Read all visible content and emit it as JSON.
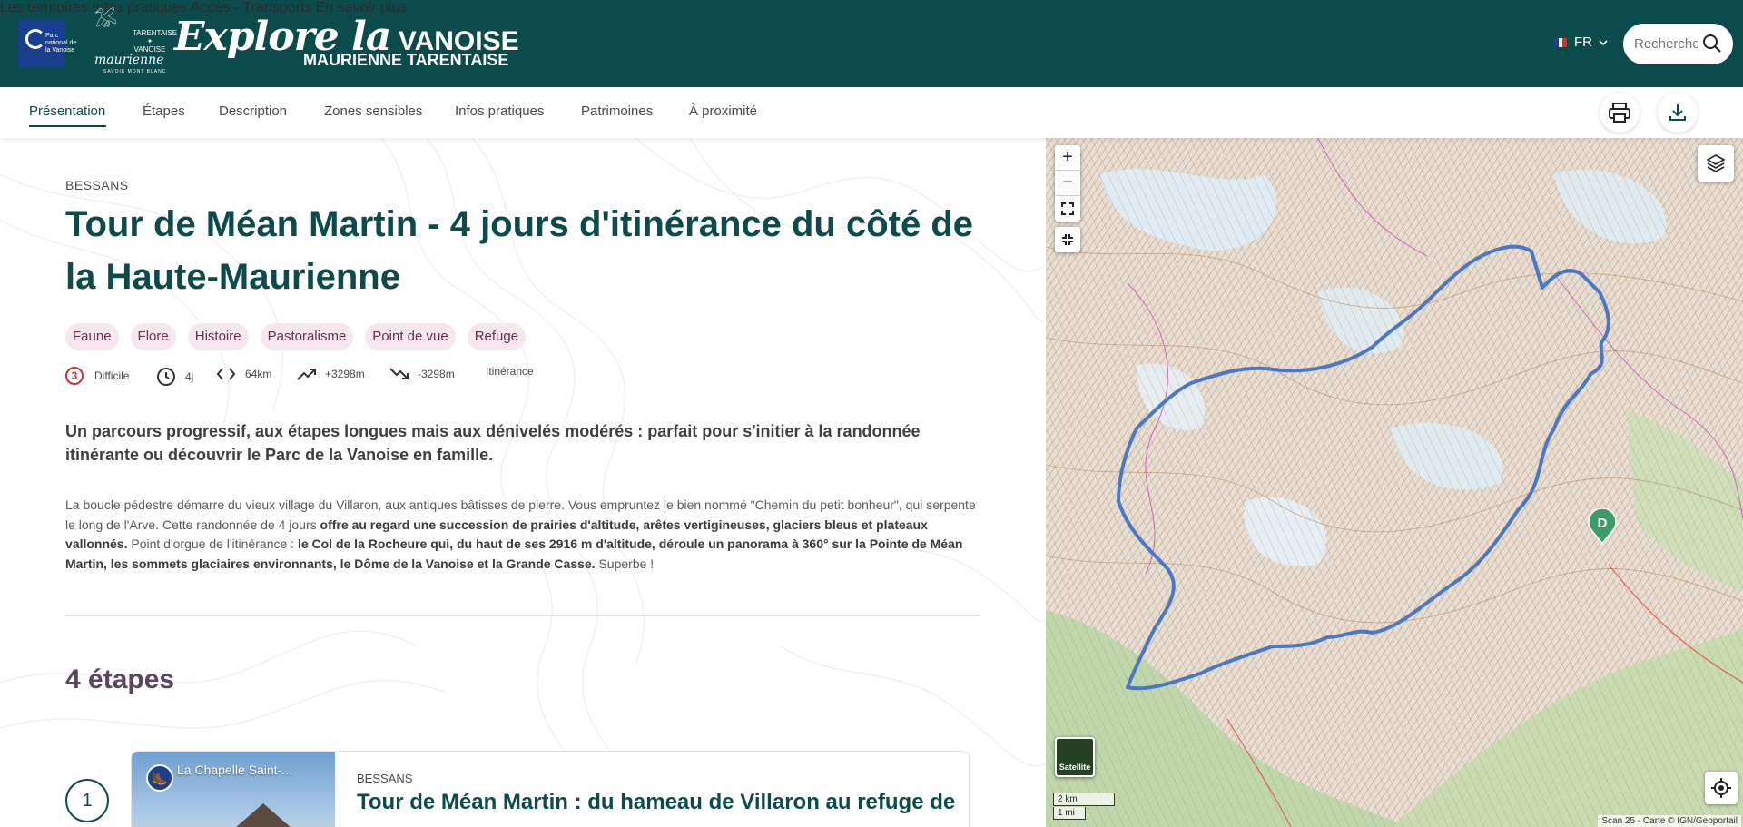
{
  "header": {
    "park_logo_text": "Parc national de la Vanoise",
    "tarentaise_text": "TARENTAISE ✦ VANOISE",
    "maurienne_text": "maurienne",
    "maurienne_sub": "SAVOIE MONT BLANC",
    "brand_script": "Explore la",
    "brand_caps": "VANOISE",
    "brand_sub": "MAURIENNE TARENTAISE",
    "nav": [
      {
        "label": "Les territoires"
      },
      {
        "label": "Infos pratiques"
      },
      {
        "label": "Accès - Transports"
      },
      {
        "label": "En savoir plus"
      }
    ],
    "language": "FR",
    "search_placeholder": "Recherche"
  },
  "subnav": {
    "tabs": [
      {
        "label": "Présentation",
        "active": true
      },
      {
        "label": "Étapes"
      },
      {
        "label": "Description"
      },
      {
        "label": "Zones sensibles"
      },
      {
        "label": "Infos pratiques"
      },
      {
        "label": "Patrimoines"
      },
      {
        "label": "À proximité"
      }
    ]
  },
  "trek": {
    "place": "BESSANS",
    "title": "Tour de Méan Martin - 4 jours d'itinérance du côté de la Haute-Maurienne",
    "tags": [
      "Faune",
      "Flore",
      "Histoire",
      "Pastoralisme",
      "Point de vue",
      "Refuge"
    ],
    "stats": {
      "difficulty_level": "3",
      "difficulty": "Difficile",
      "duration": "4j",
      "distance": "64km",
      "ascent": "+3298m",
      "descent": "-3298m",
      "practice": "Itinérance"
    },
    "lead": "Un parcours progressif, aux étapes longues mais aux dénivelés modérés : parfait pour s'initier à la randonnée itinérante ou découvrir le Parc de la Vanoise en famille.",
    "desc": {
      "p1": "La boucle pédestre démarre du vieux village du Villaron, aux antiques bâtisses de pierre. Vous empruntez le bien nommé \"Chemin du petit bonheur\", qui serpente le long de l'Arve. Cette randonnée de 4 jours ",
      "b1": "offre au regard une succession de prairies d'altitude, arêtes vertigineuses, glaciers bleus et plateaux vallonnés.",
      "p2": " Point d'orgue de l'itinérance : ",
      "b2": "le Col de la Rocheure qui, du haut de ses 2916 m d'altitude, déroule un panorama à 360° sur la Pointe de Méan Martin, les sommets glaciaires environnants, le Dôme de la Vanoise et la Grande Casse.",
      "p3": " Superbe !"
    }
  },
  "stages": {
    "heading": "4 étapes",
    "items": [
      {
        "number": "1",
        "photo_caption": "La Chapelle Saint-...",
        "place": "BESSANS",
        "title": "Tour de Méan Martin : du hameau de Villaron au refuge de"
      }
    ]
  },
  "map": {
    "zoom_in": "+",
    "zoom_out": "−",
    "satellite_label": "Satellite",
    "scale_km": "2 km",
    "scale_mi": "1 mi",
    "attribution": "Scan 25 - Carte © IGN/Geoportail",
    "marker_label": "D",
    "route_color": "#4a78c8",
    "marker_color": "#3f9a6a"
  },
  "colors": {
    "brand": "#0b4b4b",
    "tag_bg": "#f6e7ee",
    "tag_text": "#6d2f4b",
    "difficulty": "#d0322f"
  }
}
